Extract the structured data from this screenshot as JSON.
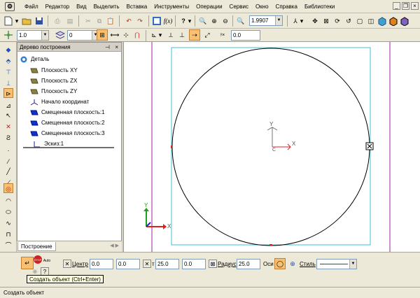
{
  "menu": {
    "items": [
      "Файл",
      "Редактор",
      "Вид",
      "Выделить",
      "Вставка",
      "Инструменты",
      "Операции",
      "Сервис",
      "Окно",
      "Справка",
      "Библиотеки"
    ]
  },
  "toolbar": {
    "zoom_value": "1.9907",
    "fx_label": "f(x)",
    "line_scale_value": "1.0",
    "layer_value": "0",
    "step_value": "0.0"
  },
  "tree": {
    "title": "Дерево построения",
    "root": "Деталь",
    "items": [
      "Плоскость XY",
      "Плоскость ZX",
      "Плоскость ZY",
      "Начало координат",
      "Смещенная плоскость:1",
      "Смещенная плоскость:2",
      "Смещенная плоскость:3",
      "Эскиз:1"
    ],
    "tab_label": "Построение"
  },
  "canvas": {
    "axis_x": "X",
    "axis_y": "Y",
    "origin_label": "C"
  },
  "properties": {
    "center_label": "Центр",
    "center_x": "0.0",
    "center_y": "0.0",
    "point_label": "т",
    "point_x": "25.0",
    "point_y": "0.0",
    "radius_label": "Радиус",
    "radius_value": "25.0",
    "axes_label": "Оси",
    "style_label": "Стиль",
    "auto_label": "Auto",
    "stop_label": "STOP"
  },
  "tooltip": "Создать объект (Ctrl+Enter)",
  "status": "Создать объект",
  "colors": {
    "frame_magenta": "#a020a0",
    "frame_cyan": "#40c0d0",
    "circle": "#000000",
    "axis_red": "#e02020",
    "axis_green": "#20a020",
    "axis_blue": "#2020e0"
  }
}
